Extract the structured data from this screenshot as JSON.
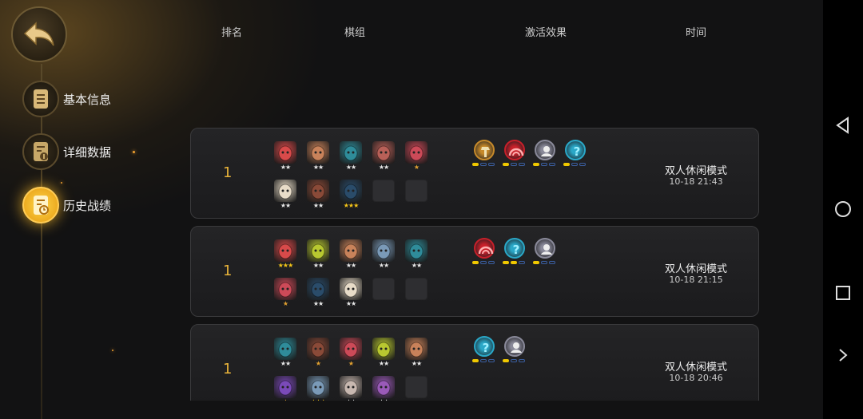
{
  "sidebar": {
    "items": [
      {
        "label": "基本信息",
        "icon": "document-icon",
        "active": false
      },
      {
        "label": "详细数据",
        "icon": "stats-doc-icon",
        "active": false
      },
      {
        "label": "历史战绩",
        "icon": "history-doc-icon",
        "active": true
      }
    ]
  },
  "table": {
    "headers": {
      "rank": "排名",
      "lineup": "棋组",
      "effects": "激活效果",
      "time": "时间"
    }
  },
  "records": [
    {
      "rank": "1",
      "units": [
        {
          "color": "#d84a4a",
          "stars": "★★"
        },
        {
          "color": "#c8825a",
          "stars": "★★"
        },
        {
          "color": "#2f8c9a",
          "stars": "★★"
        },
        {
          "color": "#b86058",
          "stars": "★★"
        },
        {
          "color": "#cc4a58",
          "stars": "★"
        },
        {
          "color": "#e8dcc8",
          "stars": "★★"
        },
        {
          "color": "#8a4a38",
          "stars": "★★"
        },
        {
          "color": "#2a4c6a",
          "stars": "★★★"
        },
        {
          "color": "",
          "stars": ""
        },
        {
          "color": "",
          "stars": ""
        }
      ],
      "traits": [
        {
          "icon": "hammer-icon",
          "color": "#c78a2a",
          "level": 1
        },
        {
          "icon": "dome-icon",
          "color": "#c8202a",
          "level": 1
        },
        {
          "icon": "person-icon",
          "color": "#8a8a9a",
          "level": 1
        },
        {
          "icon": "question-icon",
          "color": "#2aa8c8",
          "level": 1
        }
      ],
      "mode": "双人休闲模式",
      "time": "10-18 21:43"
    },
    {
      "rank": "1",
      "units": [
        {
          "color": "#d84a4a",
          "stars": "★★★"
        },
        {
          "color": "#b8c830",
          "stars": "★★"
        },
        {
          "color": "#c8825a",
          "stars": "★★"
        },
        {
          "color": "#7a9ab8",
          "stars": "★★"
        },
        {
          "color": "#2f8c9a",
          "stars": "★★"
        },
        {
          "color": "#cc4a58",
          "stars": "★"
        },
        {
          "color": "#2a4c6a",
          "stars": "★★"
        },
        {
          "color": "#e8dcc8",
          "stars": "★★"
        },
        {
          "color": "",
          "stars": ""
        },
        {
          "color": "",
          "stars": ""
        }
      ],
      "traits": [
        {
          "icon": "dome-icon",
          "color": "#c8202a",
          "level": 1
        },
        {
          "icon": "question-icon",
          "color": "#2aa8c8",
          "level": 2
        },
        {
          "icon": "person-icon",
          "color": "#8a8a9a",
          "level": 1
        }
      ],
      "mode": "双人休闲模式",
      "time": "10-18 21:15"
    },
    {
      "rank": "1",
      "units": [
        {
          "color": "#2f8c9a",
          "stars": "★★"
        },
        {
          "color": "#8a4a38",
          "stars": "★"
        },
        {
          "color": "#cc4a58",
          "stars": "★"
        },
        {
          "color": "#b8c830",
          "stars": "★★"
        },
        {
          "color": "#c8825a",
          "stars": "★★"
        },
        {
          "color": "#7a4ab8",
          "stars": "★"
        },
        {
          "color": "#7a9ab8",
          "stars": "★★★"
        },
        {
          "color": "#c8b8b0",
          "stars": "★★"
        },
        {
          "color": "#9a5ab8",
          "stars": "★★"
        },
        {
          "color": "",
          "stars": ""
        }
      ],
      "traits": [
        {
          "icon": "question-icon",
          "color": "#2aa8c8",
          "level": 1
        },
        {
          "icon": "person-icon",
          "color": "#8a8a9a",
          "level": 1
        }
      ],
      "mode": "双人休闲模式",
      "time": "10-18 20:46"
    }
  ],
  "colors": {
    "accent": "#e8b33a",
    "active_glow": "#ffd64a",
    "trait_on": "#f0c800"
  }
}
